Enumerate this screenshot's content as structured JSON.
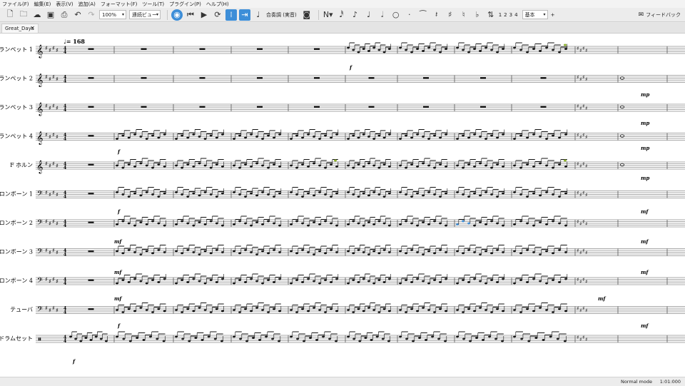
{
  "menu": [
    "ファイル(F)",
    "編集(E)",
    "表示(V)",
    "追加(A)",
    "フォーマット(F)",
    "ツール(T)",
    "プラグイン(P)",
    "ヘルプ(H)"
  ],
  "toolbar": {
    "zoom": "100%",
    "view_mode": "連続ビュー",
    "concert_pitch": "合奏調 (実音)",
    "voices": [
      "1",
      "2",
      "3",
      "4"
    ],
    "workspace": "基本",
    "feedback": "フィードバック",
    "icons": [
      "new-file-icon",
      "open-folder-icon",
      "upload-icon",
      "save-icon",
      "print-icon",
      "undo-icon",
      "redo-icon"
    ]
  },
  "tab": {
    "label": "Great_Days",
    "close": "✕"
  },
  "score": {
    "tempo": "♩= 168",
    "instruments": [
      "トランペット 1",
      "トランペット 2",
      "トランペット 3",
      "トランペット 4",
      "F ホルン",
      "トロンボーン 1",
      "トロンボーン 2",
      "トロンボーン 3",
      "トロンボーン 4",
      "テューバ",
      "ドラムセット"
    ],
    "clefs": [
      "treble",
      "treble",
      "treble",
      "treble",
      "treble",
      "bass",
      "bass",
      "bass",
      "bass",
      "bass",
      "percussion"
    ],
    "time_signature": "4/4",
    "dynamics": {
      "trumpet1": "f",
      "trumpet2": "mp",
      "trumpet3": "mp",
      "trumpet4": [
        "f",
        "mp"
      ],
      "horn": "mp",
      "trombone1": [
        "f",
        "mf"
      ],
      "trombone2": [
        "mf",
        "mf"
      ],
      "trombone3": [
        "mf",
        "mf"
      ],
      "trombone4": [
        "mf",
        "mf"
      ],
      "tuba": [
        "f",
        "mf"
      ],
      "drums": "f"
    },
    "selection_color": "#3d8ed8",
    "highlight_color": "#8fb32e"
  },
  "status": {
    "mode": "Normal mode",
    "time": "1:01:000"
  }
}
